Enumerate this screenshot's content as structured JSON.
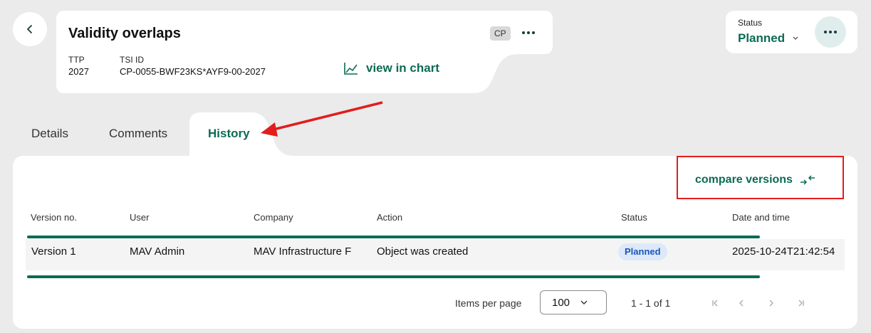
{
  "header": {
    "title": "Validity overlaps",
    "badge": "CP",
    "ttp_label": "TTP",
    "ttp_value": "2027",
    "tsi_label": "TSI ID",
    "tsi_value": "CP-0055-BWF23KS*AYF9-00-2027",
    "view_chart_label": "view in chart"
  },
  "status": {
    "label": "Status",
    "value": "Planned"
  },
  "tabs": [
    {
      "label": "Details"
    },
    {
      "label": "Comments"
    },
    {
      "label": "History",
      "active": true
    }
  ],
  "history": {
    "compare_label": "compare versions",
    "columns": [
      "Version no.",
      "User",
      "Company",
      "Action",
      "Status",
      "Date and time"
    ],
    "rows": [
      {
        "version": "Version 1",
        "user": "MAV Admin",
        "company": "MAV Infrastructure F",
        "action": "Object was created",
        "status": "Planned",
        "datetime": "2025-10-24T21:42:54"
      }
    ]
  },
  "pagination": {
    "items_per_page_label": "Items per page",
    "items_per_page": "100",
    "range": "1 - 1 of 1"
  },
  "colors": {
    "accent": "#0b6b55",
    "highlight": "#e21d1d",
    "background": "#ebebeb",
    "status_pill_bg": "#dde9f8",
    "status_pill_text": "#1a56b8"
  }
}
